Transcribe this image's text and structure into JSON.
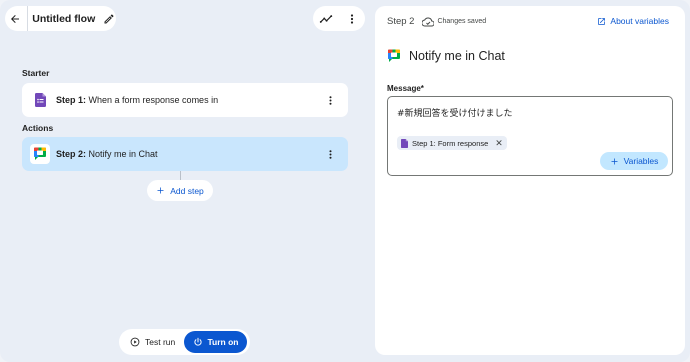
{
  "header": {
    "flow_title": "Untitled flow"
  },
  "canvas": {
    "starter_label": "Starter",
    "actions_label": "Actions",
    "steps": [
      {
        "prefix": "Step 1:",
        "text": " When a form response comes in",
        "icon": "google-forms-icon"
      },
      {
        "prefix": "Step 2:",
        "text": " Notify me in Chat",
        "icon": "google-chat-icon"
      }
    ],
    "add_step_label": "Add step"
  },
  "bottom": {
    "test_run_label": "Test run",
    "turn_on_label": "Turn on"
  },
  "panel": {
    "step_label": "Step 2",
    "saved_status": "Changes saved",
    "about_variables": "About variables",
    "title": "Notify me in Chat",
    "message_label": "Message*",
    "message_text": "#新規回答を受け付けました",
    "chip_label": "Step 1: Form response",
    "variables_button": "Variables"
  },
  "colors": {
    "accent": "#0b57d0",
    "active_step_bg": "#c9e6fd",
    "canvas_bg": "#e9eef6",
    "forms_purple": "#7248b9"
  }
}
